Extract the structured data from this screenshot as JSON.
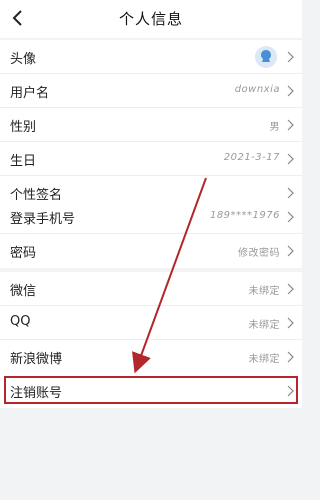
{
  "header": {
    "title": "个人信息",
    "back_icon": "chevron-left-icon"
  },
  "section_basic": {
    "avatar_label": "头像",
    "username_label": "用户名",
    "username_value": "downxia",
    "gender_label": "性别",
    "gender_value": "男",
    "birthday_label": "生日",
    "birthday_value": "2021-3-17",
    "signature_label": "个性签名"
  },
  "section_account": {
    "phone_label": "登录手机号",
    "phone_value": "189****1976",
    "password_label": "密码",
    "password_value": "修改密码"
  },
  "section_bind": {
    "wechat_label": "微信",
    "wechat_value": "未绑定",
    "qq_label": "QQ",
    "qq_value": "未绑定",
    "weibo_label": "新浪微博",
    "weibo_value": "未绑定"
  },
  "section_cancel": {
    "cancel_label": "注销账号"
  },
  "annotation": {
    "color": "#b3262b"
  }
}
